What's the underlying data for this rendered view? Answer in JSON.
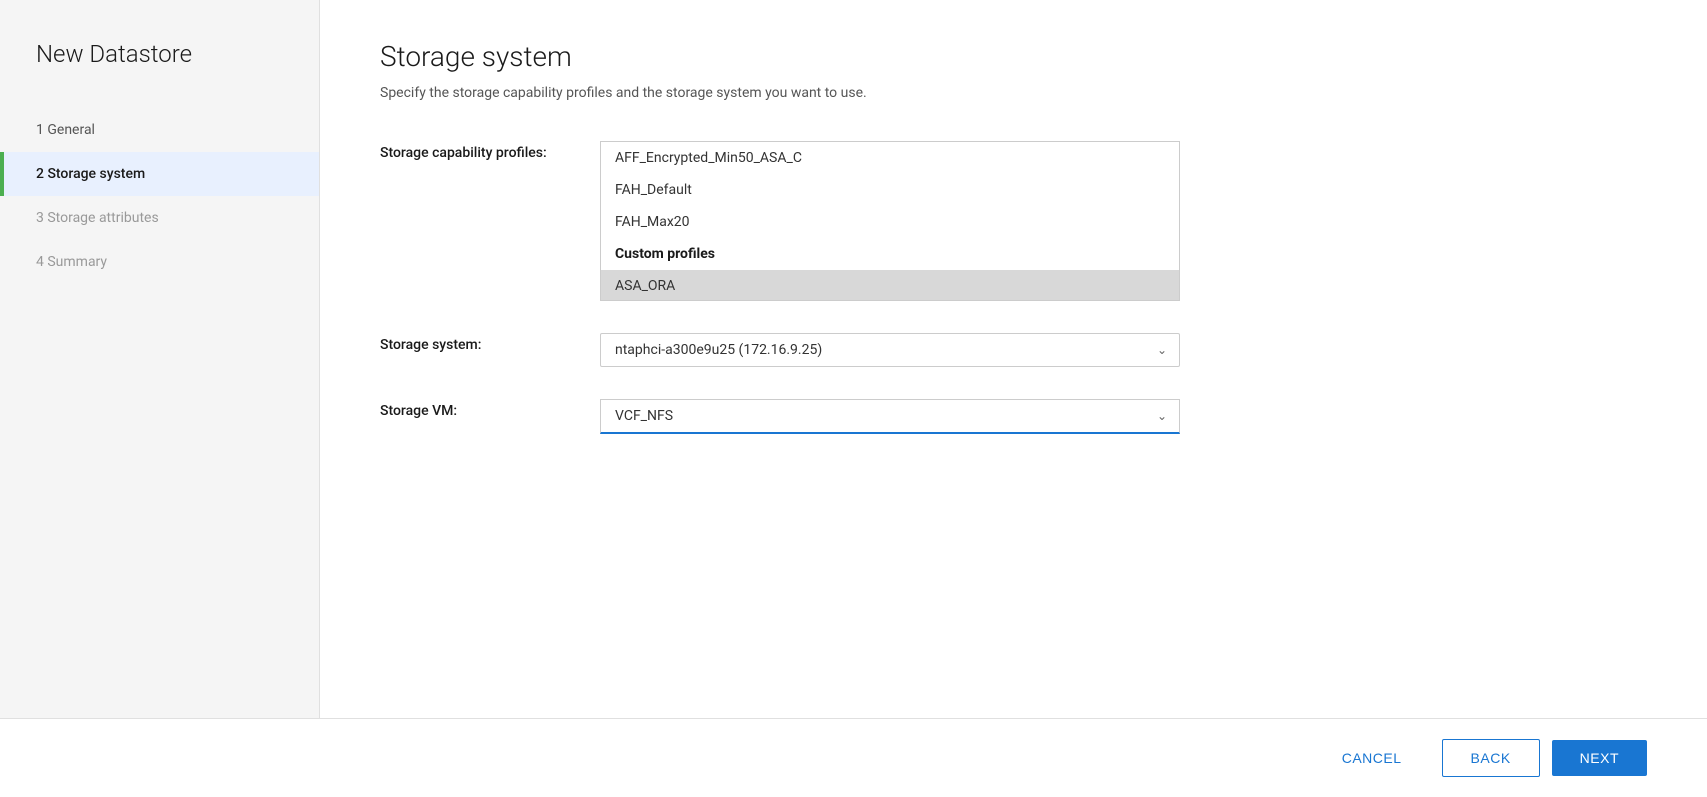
{
  "sidebar": {
    "title": "New Datastore",
    "steps": [
      {
        "id": "general",
        "number": "1",
        "label": "General",
        "state": "completed"
      },
      {
        "id": "storage-system",
        "number": "2",
        "label": "Storage system",
        "state": "active"
      },
      {
        "id": "storage-attributes",
        "number": "3",
        "label": "Storage attributes",
        "state": "inactive"
      },
      {
        "id": "summary",
        "number": "4",
        "label": "Summary",
        "state": "inactive"
      }
    ]
  },
  "main": {
    "title": "Storage system",
    "subtitle": "Specify the storage capability profiles and the storage system you want to use.",
    "fields": {
      "storage_capability_profiles_label": "Storage capability profiles:",
      "storage_system_label": "Storage system:",
      "storage_vm_label": "Storage VM:"
    },
    "profiles": {
      "items": [
        {
          "id": "aff-encrypted",
          "label": "AFF_Encrypted_Min50_ASA_C",
          "type": "item",
          "selected": false
        },
        {
          "id": "fah-default",
          "label": "FAH_Default",
          "type": "item",
          "selected": false
        },
        {
          "id": "fah-max20",
          "label": "FAH_Max20",
          "type": "item",
          "selected": false
        },
        {
          "id": "custom-profiles",
          "label": "Custom profiles",
          "type": "group-header",
          "selected": false
        },
        {
          "id": "asa-ora",
          "label": "ASA_ORA",
          "type": "item",
          "selected": true
        }
      ]
    },
    "storage_system": {
      "value": "ntaphci-a300e9u25 (172.16.9.25)"
    },
    "storage_vm": {
      "value": "VCF_NFS"
    }
  },
  "footer": {
    "cancel_label": "CANCEL",
    "back_label": "BACK",
    "next_label": "NEXT"
  }
}
